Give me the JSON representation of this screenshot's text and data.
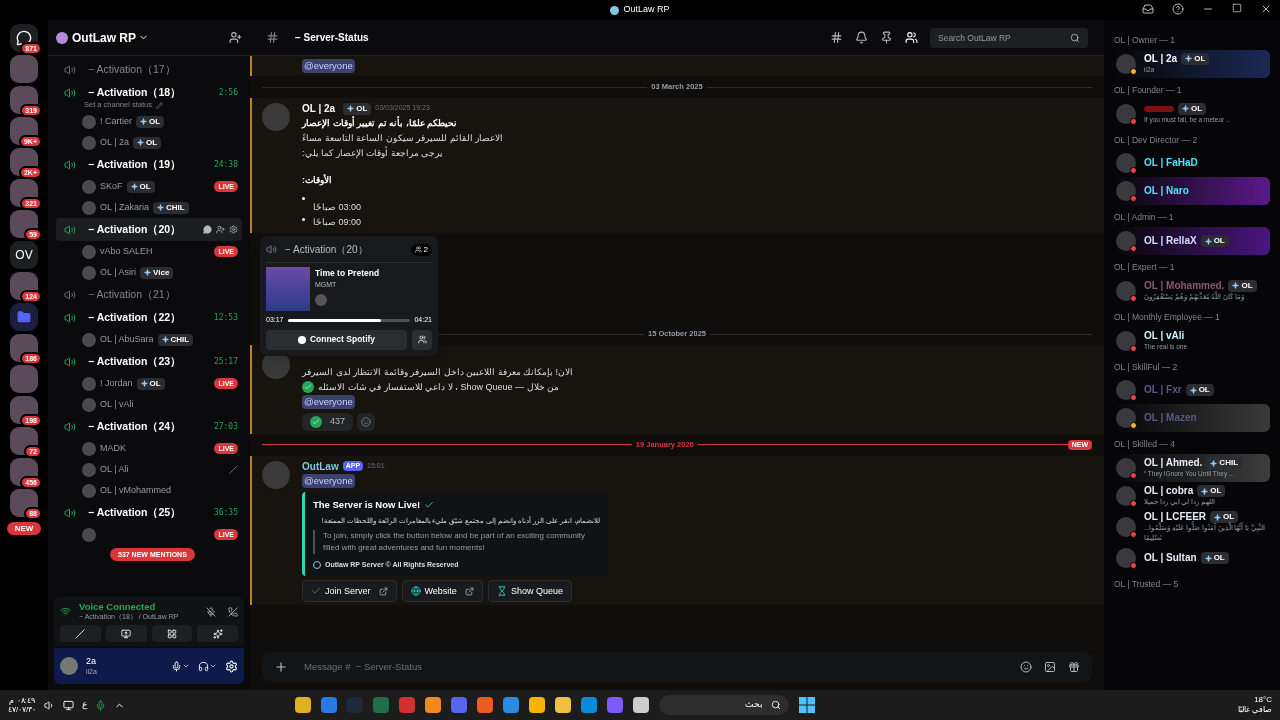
{
  "window": {
    "title": "OutLaw RP"
  },
  "servers": [
    {
      "badge": "871",
      "kind": "home"
    },
    {
      "kind": "image"
    },
    {
      "badge": "319",
      "kind": "image"
    },
    {
      "badge": "9K+",
      "kind": "image"
    },
    {
      "badge": "2K+",
      "kind": "image"
    },
    {
      "badge": "321",
      "kind": "image"
    },
    {
      "badge": "59",
      "kind": "image"
    },
    {
      "label": "OV",
      "kind": "text"
    },
    {
      "badge": "124",
      "kind": "image"
    },
    {
      "kind": "folder"
    },
    {
      "badge": "186",
      "kind": "image"
    },
    {
      "kind": "image"
    },
    {
      "badge": "198",
      "kind": "image"
    },
    {
      "badge": "72",
      "kind": "image"
    },
    {
      "badge": "456",
      "kind": "image"
    },
    {
      "badge": "88",
      "kind": "image"
    }
  ],
  "new_pill": "NEW",
  "server": {
    "name": "OutLaw RP"
  },
  "channels": [
    {
      "name": "− Activation（17）",
      "active": false,
      "hovered": false
    },
    {
      "name": "− Activation（18）",
      "active": true,
      "hovered": false,
      "timer": "2:56",
      "status": "Set a channel status",
      "users": [
        {
          "name": "! Cartier",
          "tag": "OL",
          "deafened": false
        },
        {
          "name": "OL | 2a",
          "tag": "OL",
          "deafened": false
        }
      ]
    },
    {
      "name": "− Activation（19）",
      "active": true,
      "hovered": false,
      "timer": "24:38",
      "users": [
        {
          "name": "SKoF",
          "tag": "OL",
          "badge": "LIVE",
          "deafened": false
        },
        {
          "name": "OL | Zakaria",
          "tag": "CHIL",
          "deafened": false
        }
      ]
    },
    {
      "name": "− Activation（20）",
      "active": true,
      "hovered": true,
      "users": [
        {
          "name": "vAbo SALEH",
          "badge": "LIVE",
          "deafened": false
        },
        {
          "name": "OL | Asiri",
          "tag": "Vice",
          "deafened": false
        }
      ]
    },
    {
      "name": "− Activation（21）",
      "active": false,
      "hovered": false
    },
    {
      "name": "− Activation（22）",
      "active": true,
      "hovered": false,
      "timer": "12:53",
      "users": [
        {
          "name": "OL | AbuSara",
          "tag": "CHIL",
          "deafened": false
        }
      ]
    },
    {
      "name": "− Activation（23）",
      "active": true,
      "hovered": false,
      "timer": "25:17",
      "users": [
        {
          "name": "! Jordan",
          "tag": "OL",
          "badge": "LIVE",
          "deafened": false
        },
        {
          "name": "OL | vAli",
          "deafened": false
        }
      ]
    },
    {
      "name": "− Activation（24）",
      "active": true,
      "hovered": false,
      "timer": "27:03",
      "users": [
        {
          "name": "MADK",
          "badge": "LIVE",
          "deafened": false
        },
        {
          "name": "OL | Ali",
          "deafened": true
        },
        {
          "name": "OL | vMohammed",
          "deafened": false
        }
      ]
    },
    {
      "name": "− Activation（25）",
      "active": true,
      "hovered": false,
      "timer": "36:35",
      "users": [
        {
          "badge": "LIVE",
          "deafened": false
        }
      ]
    }
  ],
  "mentions_pill": "537 NEW MENTIONS",
  "voice": {
    "title": "Voice Connected",
    "channel": "− Activation（18） / OutLaw RP"
  },
  "user": {
    "name": "2a",
    "status": "ii2a"
  },
  "header": {
    "channel": "− Server-Status",
    "search_placeholder": "Search OutLaw RP"
  },
  "messages": [
    {
      "kind": "tail",
      "mentioned": true,
      "lines": [
        {
          "text": "@everyone",
          "mention": true
        }
      ]
    },
    {
      "kind": "divider",
      "text": "03 March 2025",
      "new": false
    },
    {
      "kind": "message",
      "mentioned": true,
      "author": "OL | 2a",
      "tag": "OL",
      "time": "03/03/2025 19:23",
      "lines": [
        {
          "text": "نحيطكم علمًا، بأنه تم تغيير أوقات الإعصار",
          "bold": true
        },
        {
          "text": "الاعصار القائم للسيرفر سيكون الساعة التاسعة مساءً"
        },
        {
          "text": "يرجى مراجعة أوقات الإعصار كما يلي:"
        },
        {
          "text": "الأوقات:",
          "bold": true,
          "gap": true
        },
        {
          "text": "03:00 صباحًا",
          "bullet": true,
          "gap": true
        },
        {
          "text": "09:00 صباحًا",
          "bullet": true
        }
      ]
    },
    {
      "kind": "spacer"
    },
    {
      "kind": "divider",
      "text": "15 October 2025",
      "new": false
    },
    {
      "kind": "message",
      "mentioned": true,
      "lines": [
        {
          "text": "الان! بإمكانك معرفة اللاعبين داخل السيرفر وقائمة الانتظار لدى السيرفر"
        },
        {
          "text": "من خلال — Show Queue ، لا داعي للاستفسار في شات الاسئله",
          "check": true
        },
        {
          "text": "@everyone",
          "mention": true
        }
      ],
      "reaction": "437"
    },
    {
      "kind": "divider",
      "text": "19 January 2026",
      "new": true,
      "new_label": "NEW"
    },
    {
      "kind": "message",
      "mentioned": true,
      "author": "OutLaw",
      "app": "APP",
      "time": "15:01",
      "lines": [
        {
          "text": "@everyone",
          "mention": true
        }
      ],
      "embed": {
        "title": "The Server is Now Live!",
        "arabic": "للانضمام، انقر على الزر أدناه وانضم إلى مجتمع شيّق مليء بالمغامرات الرائعة واللحظات الممتعة!",
        "quote": "To join, simply click the button below and be part of an exciting community filled with great adventures and fun moments!",
        "footer": "Outlaw RP Server © All Rights Reserved"
      },
      "buttons": [
        {
          "label": "Join Server",
          "kind": "check",
          "external": true
        },
        {
          "label": "Website",
          "kind": "globe",
          "external": true
        },
        {
          "label": "Show Queue",
          "kind": "hourglass",
          "external": false
        }
      ]
    }
  ],
  "popup": {
    "channel": "− Activation（20）",
    "count": "2",
    "track": "Time to Pretend",
    "artist": "MGMT",
    "elapsed": "03:17",
    "total": "04:21",
    "level": 0.76,
    "button": "Connect Spotify"
  },
  "composer": {
    "placeholder": "Message #  − Server-Status"
  },
  "members": [
    {
      "role": "OL | Owner — 1",
      "items": [
        {
          "name": "OL | 2a",
          "tag": "OL",
          "status": "ii2a",
          "color": "#ffffff",
          "kind": "idle",
          "banner": {
            "color": "#1b2a55"
          }
        }
      ]
    },
    {
      "role": "OL | Founder — 1",
      "items": [
        {
          "tag": "OL",
          "status": "If you must fall, be a meteor ..",
          "color": "#7a1010",
          "kind": "dnd"
        }
      ]
    },
    {
      "role": "OL | Dev Director — 2",
      "items": [
        {
          "name": "OL | FaHaD",
          "color": "#4fe3ff",
          "kind": "dnd"
        },
        {
          "name": "OL | Naro",
          "color": "#4fe3ff",
          "kind": "dnd",
          "banner": {
            "color": "#5a1a8a"
          }
        }
      ]
    },
    {
      "role": "OL | Admin — 1",
      "items": [
        {
          "name": "OL | RellaX",
          "tag": "OL",
          "color": "#cfe0ff",
          "kind": "dnd",
          "banner": {
            "color": "#4a1580"
          }
        }
      ]
    },
    {
      "role": "OL | Expert — 1",
      "items": [
        {
          "name": "OL | Mohammed.",
          "tag": "OL",
          "status": "وَمَا كَانَ اللَّهُ مُعَذِّبَهُمْ وَهُمْ يَسْتَغْفِرُونَ",
          "color": "#8a5a6a",
          "kind": "dnd"
        }
      ]
    },
    {
      "role": "OL | Monthly Employee — 1",
      "items": [
        {
          "name": "OL | vAli",
          "status": "The real is one",
          "color": "#c9f3ff",
          "kind": "dnd"
        }
      ]
    },
    {
      "role": "OL | SkillFul — 2",
      "items": [
        {
          "name": "OL | Fxr",
          "tag": "OL",
          "color": "#5a5a8a",
          "kind": "dnd"
        },
        {
          "name": "OL | Mazen",
          "color": "#5a5a8a",
          "kind": "idle",
          "banner": {
            "color": "#3a3a3a"
          }
        }
      ]
    },
    {
      "role": "OL | Skilled — 4",
      "items": [
        {
          "name": "OL | Ahmed.",
          "tag": "CHIL",
          "status": "“ They iGnore You Until They ...",
          "color": "#e8eef8",
          "kind": "dnd",
          "banner": {
            "color": "#3d3d3d"
          }
        },
        {
          "name": "OL | cobra",
          "tag": "OL",
          "status": "اللهم ردا لي ابي ردا جميلا",
          "color": "#e8eef8",
          "kind": "dnd"
        },
        {
          "name": "OL | LCFEER",
          "tag": "OL",
          "status": "...النَّبِيِّ يَا أَيُّهَا الَّذِينَ آمَنُوا صَلُّوا عَلَيْهِ وَسَلِّمُوا تَسْلِيمًا",
          "color": "#e8eef8",
          "kind": "dnd"
        },
        {
          "name": "OL | Sultan",
          "tag": "OL",
          "color": "#e8eef8",
          "kind": "dnd"
        }
      ]
    },
    {
      "role": "OL | Trusted — 5"
    }
  ],
  "taskbar": {
    "time": "٠٨:٤٩ م",
    "date": "٤٧/٠٧/٣٠",
    "lang": "ع",
    "search": "بحث",
    "temp": "18°C",
    "weather": "صافي غالبًا"
  }
}
